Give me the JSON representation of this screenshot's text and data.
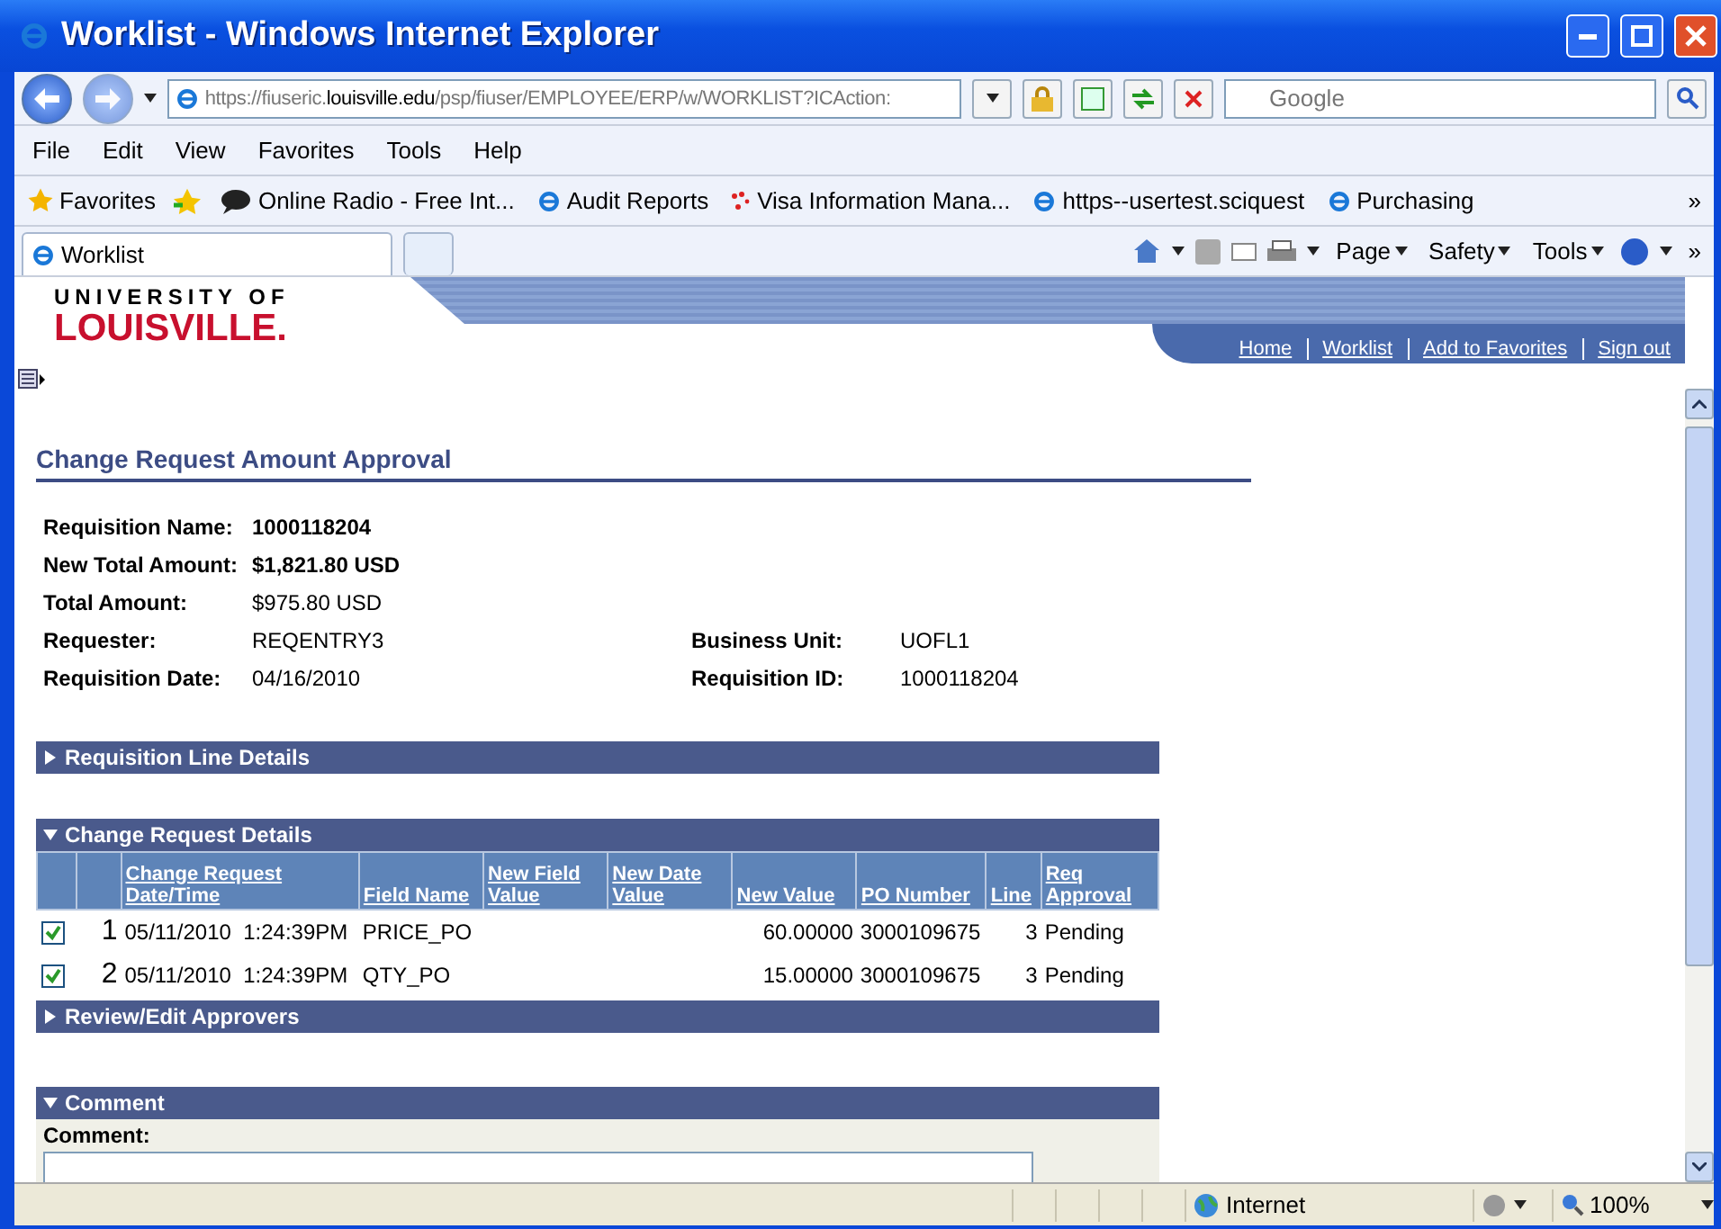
{
  "window": {
    "title": "Worklist - Windows Internet Explorer"
  },
  "address": {
    "parts": [
      {
        "kind": "dim",
        "text": "https://"
      },
      {
        "kind": "dim",
        "text": "fiuseric."
      },
      {
        "kind": "host",
        "text": "louisville.edu"
      },
      {
        "kind": "dim",
        "text": "/psp/fiuser/EMPLOYEE/ERP/w/WORKLIST?ICAction:"
      }
    ]
  },
  "search": {
    "placeholder": "Google"
  },
  "menu": [
    "File",
    "Edit",
    "View",
    "Favorites",
    "Tools",
    "Help"
  ],
  "favorites_bar": {
    "label": "Favorites",
    "items": [
      {
        "kind": "radio",
        "label": "Online Radio - Free Int..."
      },
      {
        "kind": "ie",
        "label": "Audit Reports"
      },
      {
        "kind": "visa",
        "label": "Visa Information Mana..."
      },
      {
        "kind": "ie",
        "label": "https--usertest.sciquest"
      },
      {
        "kind": "ie",
        "label": "Purchasing"
      }
    ],
    "more": "»"
  },
  "tabs": [
    {
      "label": "Worklist",
      "selected": true
    }
  ],
  "command_bar": {
    "menus": [
      "Page",
      "Safety",
      "Tools"
    ],
    "more": "»"
  },
  "logo": {
    "line_1": "UNIVERSITY OF",
    "line_2": "LOUISVILLE."
  },
  "nav_links": [
    "Home",
    "Worklist",
    "Add to Favorites",
    "Sign out"
  ],
  "page_title": "Change Request Amount Approval",
  "fields": [
    {
      "label": "Requisition Name:",
      "value": "1000118204",
      "bold": true
    },
    {
      "label": "New Total Amount:",
      "value": "$1,821.80 USD",
      "bold": true
    },
    {
      "label": "Total Amount:",
      "value": "$975.80 USD",
      "bold": false
    },
    {
      "label": "Requester:",
      "value": "REQENTRY3",
      "bold": false,
      "right_label": "Business Unit:",
      "right_value": "UOFL1"
    },
    {
      "label": "Requisition Date:",
      "value": "04/16/2010",
      "bold": false,
      "right_label": "Requisition ID:",
      "right_value": "1000118204"
    }
  ],
  "sections": [
    {
      "title": "Requisition Line Details",
      "expanded": false
    },
    {
      "title": "Change Request Details",
      "expanded": true
    },
    {
      "title": "Review/Edit Approvers",
      "expanded": false
    },
    {
      "title": "Comment",
      "expanded": true
    }
  ],
  "table": {
    "columns": [
      "Change Request Date/Time",
      "Field Name",
      "New Field Value",
      "New Date Value",
      "New Value",
      "PO Number",
      "Line",
      "Req Approval"
    ],
    "rows": [
      {
        "checked": true,
        "number": "1",
        "date": "05/11/2010",
        "time": "1:24:39PM",
        "field_name": "PRICE_PO",
        "new_value": "60.00000",
        "po_number": "3000109675",
        "line": "3",
        "status": "Pending"
      },
      {
        "checked": true,
        "number": "2",
        "date": "05/11/2010",
        "time": "1:24:39PM",
        "field_name": "QTY_PO",
        "new_value": "15.00000",
        "po_number": "3000109675",
        "line": "3",
        "status": "Pending"
      }
    ]
  },
  "comment": {
    "label": "Comment:"
  },
  "status_bar": {
    "zone": "Internet",
    "zoom": "100%"
  }
}
